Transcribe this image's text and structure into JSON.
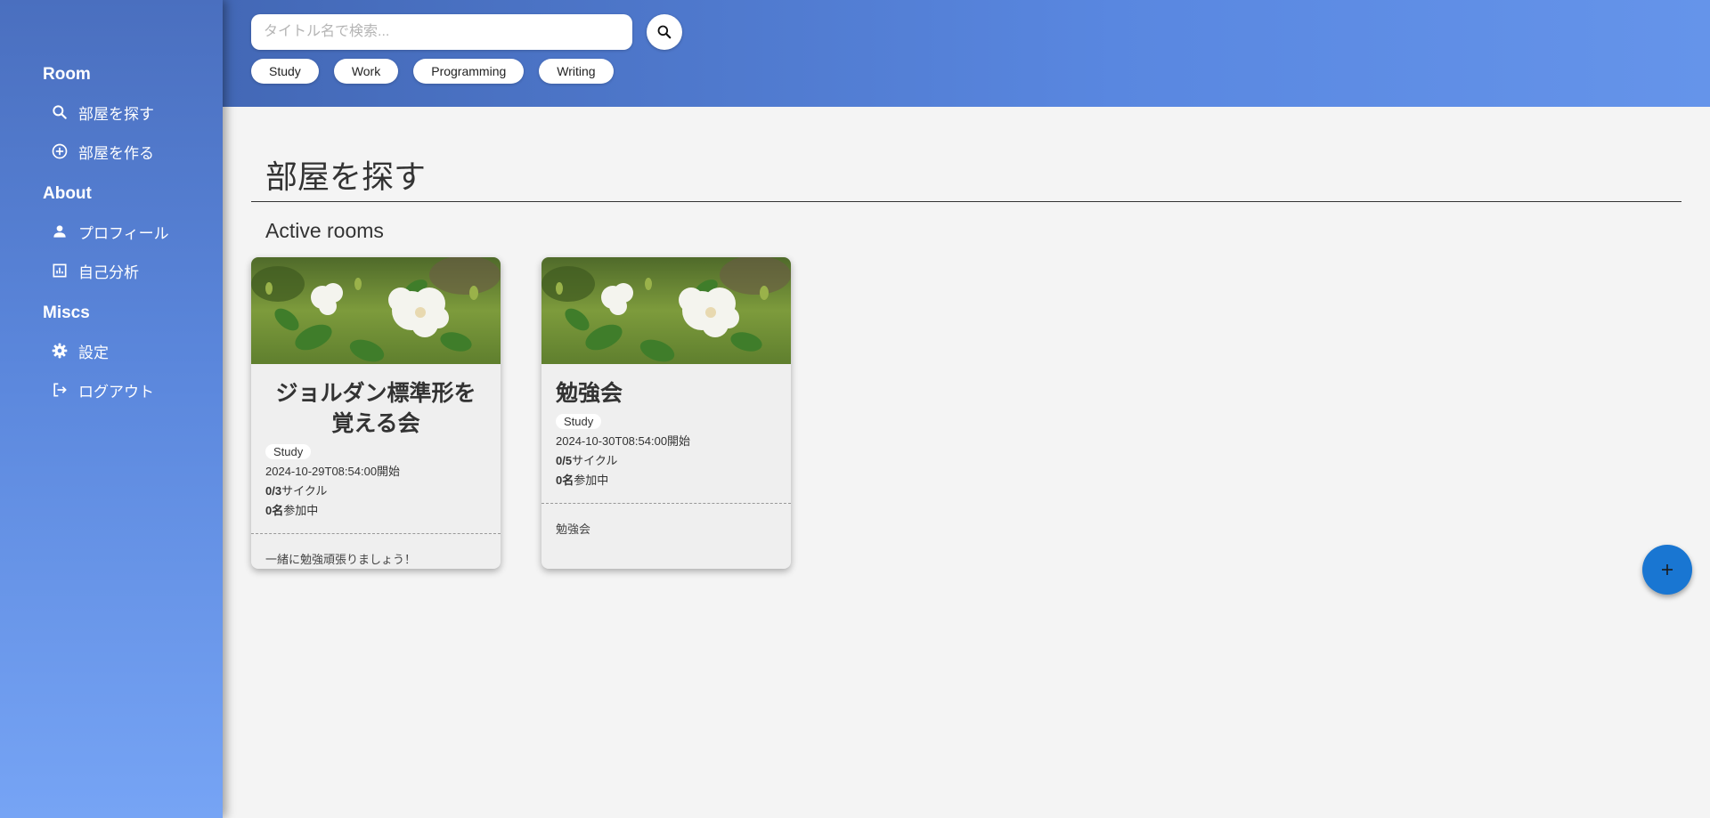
{
  "sidebar": {
    "sections": [
      {
        "heading": "Room",
        "items": [
          {
            "label": "部屋を探す",
            "icon": "search-icon"
          },
          {
            "label": "部屋を作る",
            "icon": "add-circle-icon"
          }
        ]
      },
      {
        "heading": "About",
        "items": [
          {
            "label": "プロフィール",
            "icon": "person-icon"
          },
          {
            "label": "自己分析",
            "icon": "chart-icon"
          }
        ]
      },
      {
        "heading": "Miscs",
        "items": [
          {
            "label": "設定",
            "icon": "gear-icon"
          },
          {
            "label": "ログアウト",
            "icon": "logout-icon"
          }
        ]
      }
    ]
  },
  "header": {
    "search": {
      "placeholder": "タイトル名で検索...",
      "value": ""
    },
    "search_button_icon": "search-icon",
    "chips": [
      "Study",
      "Work",
      "Programming",
      "Writing"
    ]
  },
  "main": {
    "title": "部屋を探す",
    "section_title": "Active rooms",
    "cards": [
      {
        "title": "ジョルダン標準形を覚える会",
        "tag": "Study",
        "start": "2024-10-29T08:54:00開始",
        "cycle_count": "0/3",
        "cycle_suffix": "サイクル",
        "participants": "0名",
        "participants_suffix": "参加中",
        "description": "一緒に勉強頑張りましょう！",
        "image": "white-rose-photo"
      },
      {
        "title": "勉強会",
        "tag": "Study",
        "start": "2024-10-30T08:54:00開始",
        "cycle_count": "0/5",
        "cycle_suffix": "サイクル",
        "participants": "0名",
        "participants_suffix": "参加中",
        "description": "勉強会",
        "image": "white-rose-photo"
      }
    ]
  },
  "fab": {
    "icon": "plus-icon"
  },
  "colors": {
    "sidebar_top": "#4a6fbf",
    "sidebar_bottom": "#76a4f5",
    "header_start": "#4368b6",
    "header_end": "#6594ea",
    "fab": "#1976d2",
    "background": "#f4f4f4"
  }
}
